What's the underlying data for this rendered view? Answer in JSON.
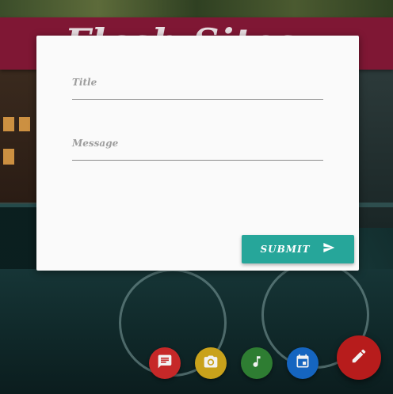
{
  "app": {
    "title": "Flash Sites"
  },
  "form": {
    "title_label": "Title",
    "message_label": "Message",
    "submit_label": "SUBMIT"
  },
  "fab": {
    "main_icon": "pencil-icon",
    "main_color": "#b71c1c",
    "actions": [
      {
        "icon": "message-icon",
        "color": "#c62828"
      },
      {
        "icon": "camera-icon",
        "color": "#c9a21b"
      },
      {
        "icon": "music-note-icon",
        "color": "#2e7d32"
      },
      {
        "icon": "calendar-icon",
        "color": "#1565c0"
      }
    ]
  },
  "colors": {
    "appbar": "#7f1734",
    "submit": "#26a69a",
    "card": "#fafafa"
  }
}
